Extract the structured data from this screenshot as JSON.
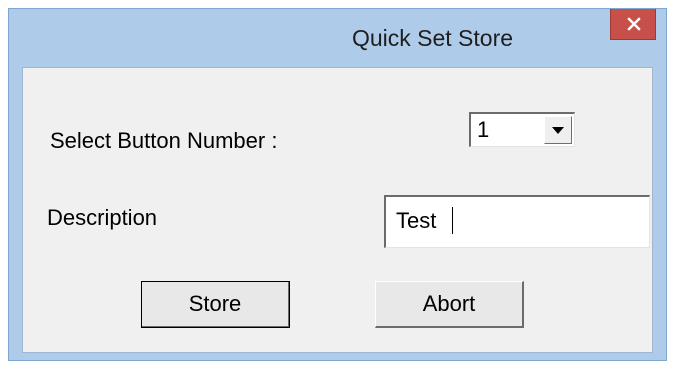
{
  "window": {
    "title": "Quick Set Store"
  },
  "form": {
    "button_number_label": "Select Button Number :",
    "button_number_value": "1",
    "description_label": "Description",
    "description_value": "Test"
  },
  "buttons": {
    "store_label": "Store",
    "abort_label": "Abort"
  },
  "colors": {
    "titlebar": "#aecbe9",
    "close_button": "#c7504a",
    "client_background": "#f0f0f0"
  }
}
